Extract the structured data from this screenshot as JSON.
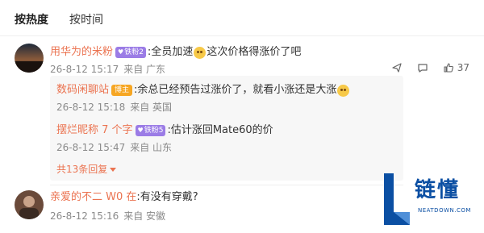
{
  "tabs": [
    {
      "label": "按热度",
      "active": true
    },
    {
      "label": "按时间",
      "active": false
    }
  ],
  "comments": [
    {
      "user": "用华为的米粉",
      "badge": "铁粉2",
      "text_before": "全员加速",
      "emoji": "doge-emoji",
      "text_after": "这次价格得涨价了吧",
      "date": "26-8-12 15:17",
      "location": "来自 广东",
      "like_count": "37"
    },
    {
      "user": "亲爱的不二 W0 在",
      "text": "有没有穿戴?",
      "date": "26-8-12 15:16",
      "location": "来自 安徽"
    }
  ],
  "replies": [
    {
      "user": "数码闲聊站",
      "badge": "博主",
      "text": "余总已经预告过涨价了，就看小涨还是大涨",
      "emoji": "grin-emoji",
      "date": "26-8-12 15:18",
      "location": "来自 英国"
    },
    {
      "user": "摆烂昵称 7 个字",
      "badge": "铁粉5",
      "text": "估计涨回Mate60的价",
      "date": "26-8-12 15:47",
      "location": "来自 山东"
    }
  ],
  "more_replies": "共13条回复",
  "colors": {
    "username": "#eb7350",
    "badge_fan": "#9b7ce6",
    "badge_blogger": "#f6a623",
    "logo": "#0b4fa3"
  },
  "logo": {
    "text": "链懂",
    "sub": "NEATDOWN.COM"
  }
}
